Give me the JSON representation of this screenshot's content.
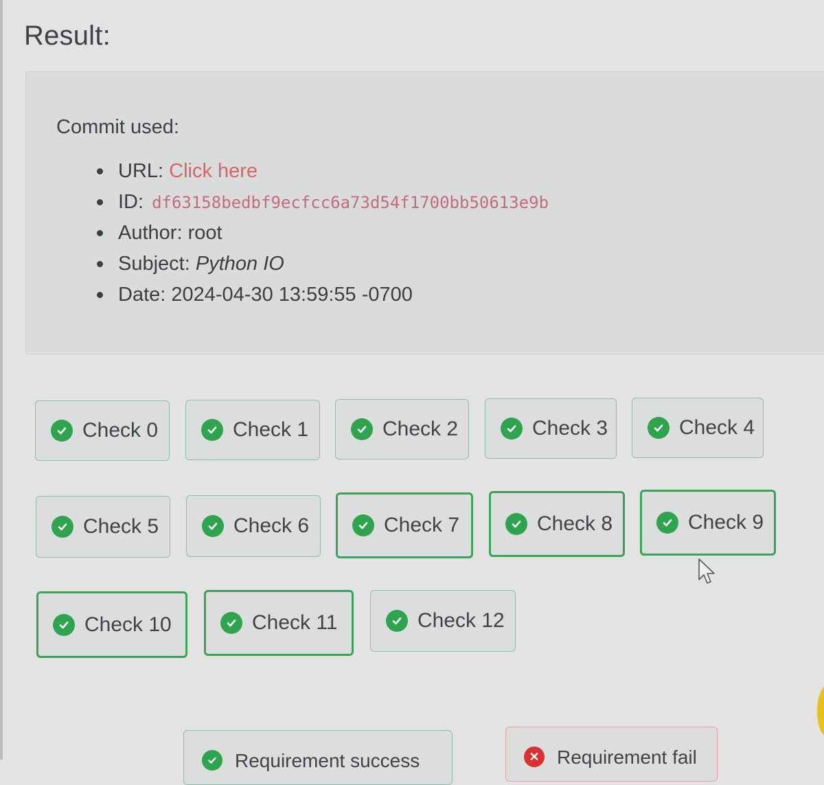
{
  "page": {
    "title": "Result:"
  },
  "commit": {
    "heading": "Commit used:",
    "url_label": "URL:",
    "url_link": "Click here",
    "id_label": "ID:",
    "id_value": "df63158bedbf9ecfcc6a73d54f1700bb50613e9b",
    "author_label": "Author:",
    "author_value": "root",
    "subject_label": "Subject:",
    "subject_value": "Python IO",
    "date_label": "Date:",
    "date_value": "2024-04-30 13:59:55 -0700"
  },
  "checks": [
    {
      "label": "Check 0",
      "status": "pass",
      "icon": "check-circle-icon"
    },
    {
      "label": "Check 1",
      "status": "pass",
      "icon": "check-circle-icon"
    },
    {
      "label": "Check 2",
      "status": "pass",
      "icon": "check-circle-icon"
    },
    {
      "label": "Check 3",
      "status": "pass",
      "icon": "check-circle-icon"
    },
    {
      "label": "Check 4",
      "status": "pass",
      "icon": "check-circle-icon"
    },
    {
      "label": "Check 5",
      "status": "pass",
      "icon": "check-circle-icon"
    },
    {
      "label": "Check 6",
      "status": "pass",
      "icon": "check-circle-icon"
    },
    {
      "label": "Check 7",
      "status": "pass",
      "icon": "check-circle-icon"
    },
    {
      "label": "Check 8",
      "status": "pass",
      "icon": "check-circle-icon"
    },
    {
      "label": "Check 9",
      "status": "pass",
      "icon": "check-circle-icon"
    },
    {
      "label": "Check 10",
      "status": "pass",
      "icon": "check-circle-icon"
    },
    {
      "label": "Check 11",
      "status": "pass",
      "icon": "check-circle-icon"
    },
    {
      "label": "Check 12",
      "status": "pass",
      "icon": "check-circle-icon"
    }
  ],
  "requirements": [
    {
      "label": "Requirement success",
      "status": "success"
    },
    {
      "label": "Requirement fail",
      "status": "fail"
    }
  ],
  "colors": {
    "success": "#2fa44f",
    "fail": "#d9312e",
    "link": "#d66666",
    "hash": "#c46b80"
  }
}
